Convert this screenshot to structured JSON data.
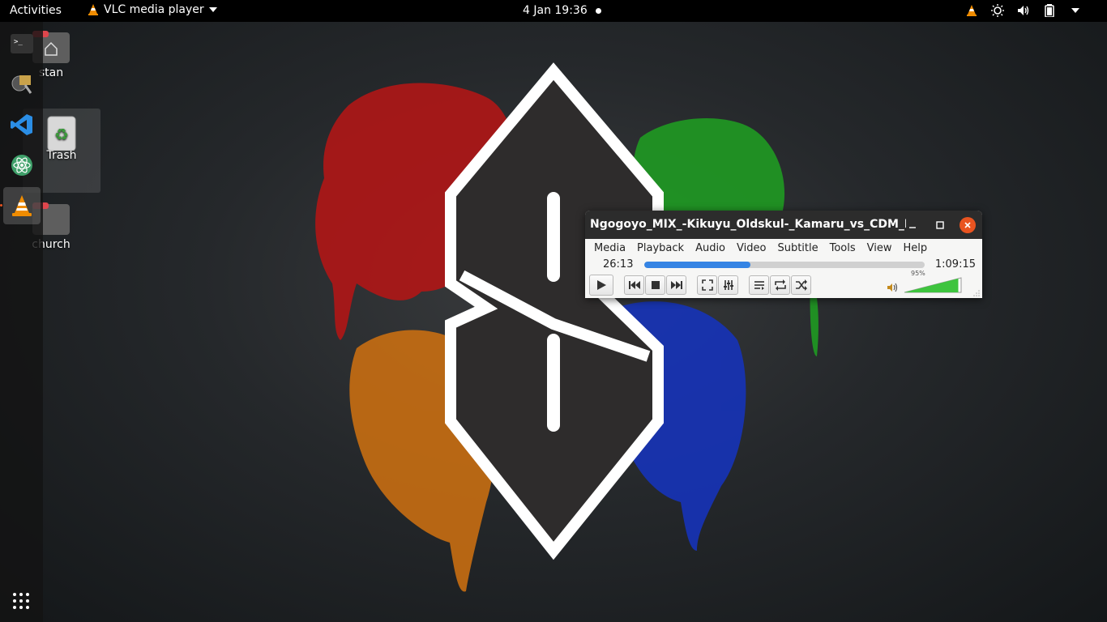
{
  "topbar": {
    "activities": "Activities",
    "app_name": "VLC media player",
    "clock": "4 Jan  19:36",
    "tray_icons": [
      "vlc-cone-icon",
      "brightness-icon",
      "volume-icon",
      "battery-icon"
    ]
  },
  "dock": {
    "items": [
      "terminal-icon",
      "software-updater-icon",
      "vscode-icon",
      "atom-icon",
      "vlc-icon"
    ],
    "active": "vlc-icon",
    "apps_grid": "show-applications-icon"
  },
  "desktop": {
    "icons": [
      {
        "label": "stan",
        "icon": "home-folder-icon"
      },
      {
        "label": "Trash",
        "icon": "trash-icon"
      },
      {
        "label": "church",
        "icon": "folder-icon"
      }
    ]
  },
  "vlc": {
    "title": "Ngogoyo_MIX_-Kikuyu_Oldskul-_Kamaru_vs_CDM_Ki...",
    "menus": [
      "Media",
      "Playback",
      "Audio",
      "Video",
      "Subtitle",
      "Tools",
      "View",
      "Help"
    ],
    "elapsed": "26:13",
    "total": "1:09:15",
    "progress": 0.38,
    "volume_label": "95%",
    "volume": 0.95,
    "accent": "#3584e4",
    "close_color": "#e95420"
  }
}
